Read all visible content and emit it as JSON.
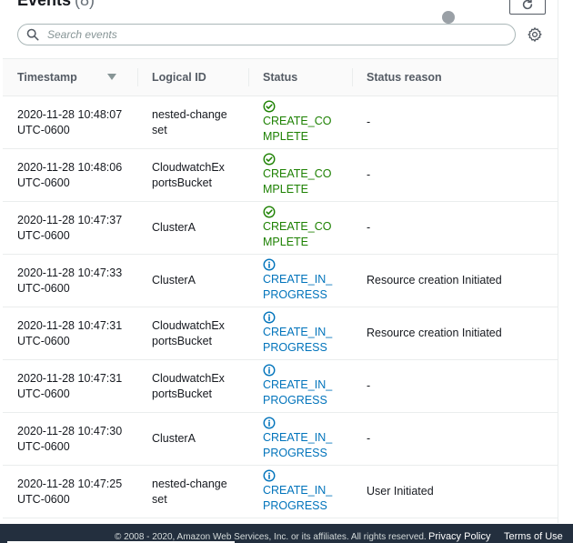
{
  "panel": {
    "title": "Events",
    "count": "(8)"
  },
  "search": {
    "placeholder": "Search events",
    "value": ""
  },
  "icons": {
    "refresh": "refresh-icon",
    "search": "search-icon",
    "settings": "gear-icon",
    "sort": "caret-down-icon",
    "complete": "check-circle-icon",
    "in_progress": "info-circle-icon"
  },
  "colors": {
    "success": "#1d8102",
    "info": "#0073bb",
    "footer_bg": "#232f3e"
  },
  "table": {
    "columns": [
      "Timestamp",
      "Logical ID",
      "Status",
      "Status reason"
    ],
    "rows": [
      {
        "timestamp": "2020-11-28 10:48:07 UTC-0600",
        "logical_id": "nested-changeset",
        "status": "CREATE_COMPLETE",
        "status_kind": "complete",
        "reason": "-"
      },
      {
        "timestamp": "2020-11-28 10:48:06 UTC-0600",
        "logical_id": "CloudwatchExportsBucket",
        "status": "CREATE_COMPLETE",
        "status_kind": "complete",
        "reason": "-"
      },
      {
        "timestamp": "2020-11-28 10:47:37 UTC-0600",
        "logical_id": "ClusterA",
        "status": "CREATE_COMPLETE",
        "status_kind": "complete",
        "reason": "-"
      },
      {
        "timestamp": "2020-11-28 10:47:33 UTC-0600",
        "logical_id": "ClusterA",
        "status": "CREATE_IN_PROGRESS",
        "status_kind": "in_progress",
        "reason": "Resource creation Initiated"
      },
      {
        "timestamp": "2020-11-28 10:47:31 UTC-0600",
        "logical_id": "CloudwatchExportsBucket",
        "status": "CREATE_IN_PROGRESS",
        "status_kind": "in_progress",
        "reason": "Resource creation Initiated"
      },
      {
        "timestamp": "2020-11-28 10:47:31 UTC-0600",
        "logical_id": "CloudwatchExportsBucket",
        "status": "CREATE_IN_PROGRESS",
        "status_kind": "in_progress",
        "reason": "-"
      },
      {
        "timestamp": "2020-11-28 10:47:30 UTC-0600",
        "logical_id": "ClusterA",
        "status": "CREATE_IN_PROGRESS",
        "status_kind": "in_progress",
        "reason": "-"
      },
      {
        "timestamp": "2020-11-28 10:47:25 UTC-0600",
        "logical_id": "nested-changeset",
        "status": "CREATE_IN_PROGRESS",
        "status_kind": "in_progress",
        "reason": "User Initiated"
      }
    ]
  },
  "footer": {
    "copyright": "© 2008 - 2020, Amazon Web Services, Inc. or its affiliates. All rights reserved.",
    "privacy": "Privacy Policy",
    "terms": "Terms of Use"
  }
}
